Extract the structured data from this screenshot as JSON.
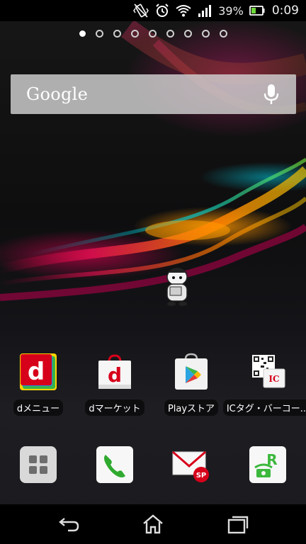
{
  "status_bar": {
    "battery_percent": "39%",
    "time": "0:09"
  },
  "home": {
    "page_count": 9,
    "active_page": 1
  },
  "search": {
    "logo_text": "Google"
  },
  "apps_row1": [
    {
      "label": "dメニュー"
    },
    {
      "label": "dマーケット"
    },
    {
      "label": "Playストア"
    },
    {
      "label": "ICタグ・バーコー..."
    }
  ],
  "colors": {
    "docomo_red": "#d7001a",
    "phone_green": "#2faa2f"
  }
}
